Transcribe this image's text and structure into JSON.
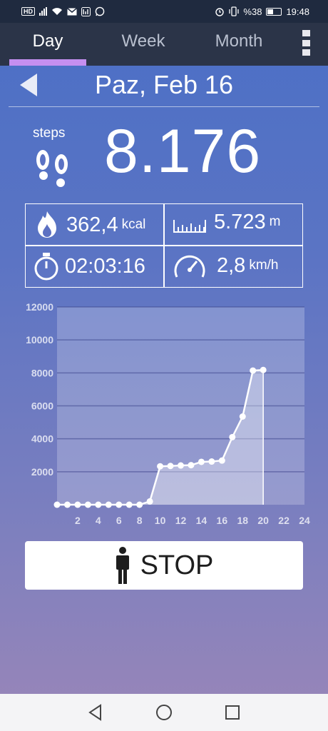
{
  "status_bar": {
    "hd_label": "HD",
    "battery_text": "%38",
    "time": "19:48"
  },
  "tabs": [
    {
      "label": "Day",
      "active": true
    },
    {
      "label": "Week",
      "active": false
    },
    {
      "label": "Month",
      "active": false
    }
  ],
  "header": {
    "date": "Paz, Feb 16"
  },
  "steps": {
    "label": "steps",
    "value": "8.176"
  },
  "stats": {
    "calories": {
      "value": "362,4",
      "unit": "kcal"
    },
    "distance": {
      "value": "5.723",
      "unit": "m"
    },
    "duration": {
      "value": "02:03:16"
    },
    "speed": {
      "value": "2,8",
      "unit": "km/h"
    }
  },
  "buttons": {
    "stop_label": "STOP"
  },
  "colors": {
    "accent_tab": "#c58ff0",
    "tab_bar": "#2b3448",
    "status_bar": "#1f2a3f"
  },
  "chart_data": {
    "type": "area",
    "x": [
      0,
      1,
      2,
      3,
      4,
      5,
      6,
      7,
      8,
      9,
      10,
      11,
      12,
      13,
      14,
      15,
      16,
      17,
      18,
      19,
      20
    ],
    "values": [
      0,
      0,
      0,
      0,
      0,
      0,
      0,
      0,
      0,
      200,
      2330,
      2350,
      2380,
      2400,
      2600,
      2620,
      2680,
      4100,
      5350,
      8140,
      8176
    ],
    "xlim": [
      0,
      24
    ],
    "ylim": [
      0,
      12000
    ],
    "x_ticks": [
      2,
      4,
      6,
      8,
      10,
      12,
      14,
      16,
      18,
      20,
      22,
      24
    ],
    "y_ticks": [
      2000,
      4000,
      6000,
      8000,
      10000,
      12000
    ],
    "grid": true,
    "xlabel": "",
    "ylabel": ""
  }
}
